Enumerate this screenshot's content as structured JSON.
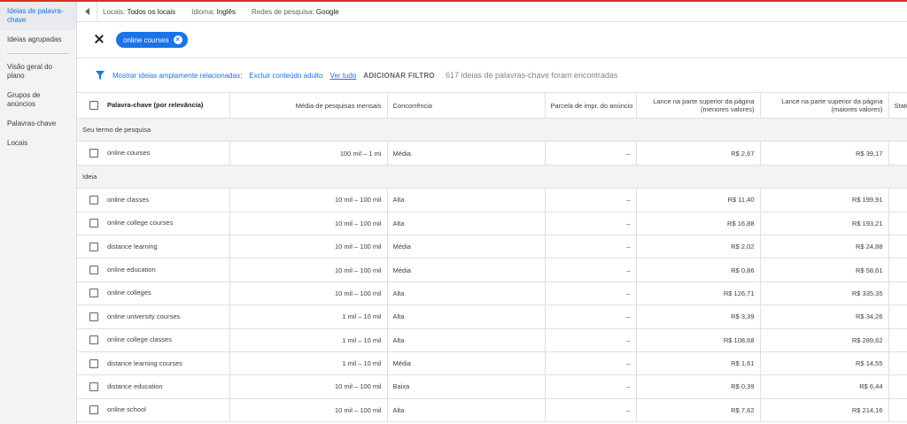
{
  "sidebar": {
    "items": [
      {
        "label": "Ideias de palavra-chave",
        "active": true
      },
      {
        "label": "Ideias agrupadas",
        "active": false
      },
      {
        "label": "Visão geral do plano",
        "active": false
      },
      {
        "label": "Grupos de anúncios",
        "active": false
      },
      {
        "label": "Palavras-chave",
        "active": false
      },
      {
        "label": "Locais",
        "active": false
      }
    ]
  },
  "topbar": {
    "locais_label": "Locais:",
    "locais_value": "Todos os locais",
    "idioma_label": "Idioma:",
    "idioma_value": "Inglês",
    "redes_label": "Redes de pesquisa:",
    "redes_value": "Google"
  },
  "chip": {
    "label": "online courses"
  },
  "filters": {
    "link1": "Mostrar ideias amplamente relacionadas;",
    "link2": "Excluir conteúdo adulto",
    "link3": "Ver tudo",
    "add_filter": "ADICIONAR FILTRO",
    "count_text": "617 ideias de palavras-chave foram encontradas"
  },
  "columns": {
    "keyword": "Palavra-chave (por relevância)",
    "avg": "Média de pesquisas mensais",
    "competition": "Concorrência",
    "share": "Parcela de impr. do anúncio",
    "bid_low": "Lance na parte superior da página (menores valores)",
    "bid_high": "Lance na parte superior da página (maiores valores)",
    "status": "Status"
  },
  "sections": {
    "term": "Seu termo de pesquisa",
    "ideas": "Ideia"
  },
  "term_row": {
    "keyword": "online courses",
    "avg": "100 mil – 1 mi",
    "competition": "Média",
    "share": "–",
    "bid_low": "R$ 2,67",
    "bid_high": "R$ 39,17"
  },
  "idea_rows": [
    {
      "keyword": "online classes",
      "avg": "10 mil – 100 mil",
      "competition": "Alta",
      "share": "–",
      "bid_low": "R$ 11,40",
      "bid_high": "R$ 199,91"
    },
    {
      "keyword": "online college courses",
      "avg": "10 mil – 100 mil",
      "competition": "Alta",
      "share": "–",
      "bid_low": "R$ 16,88",
      "bid_high": "R$ 193,21"
    },
    {
      "keyword": "distance learning",
      "avg": "10 mil – 100 mil",
      "competition": "Média",
      "share": "–",
      "bid_low": "R$ 2,02",
      "bid_high": "R$ 24,88"
    },
    {
      "keyword": "online education",
      "avg": "10 mil – 100 mil",
      "competition": "Média",
      "share": "–",
      "bid_low": "R$ 0,86",
      "bid_high": "R$ 58,61"
    },
    {
      "keyword": "online colleges",
      "avg": "10 mil – 100 mil",
      "competition": "Alta",
      "share": "–",
      "bid_low": "R$ 126,71",
      "bid_high": "R$ 335,35"
    },
    {
      "keyword": "online university courses",
      "avg": "1 mil – 10 mil",
      "competition": "Alta",
      "share": "–",
      "bid_low": "R$ 3,39",
      "bid_high": "R$ 34,26"
    },
    {
      "keyword": "online college classes",
      "avg": "1 mil – 10 mil",
      "competition": "Alta",
      "share": "–",
      "bid_low": "R$ 108,68",
      "bid_high": "R$ 289,62"
    },
    {
      "keyword": "distance learning courses",
      "avg": "1 mil – 10 mil",
      "competition": "Média",
      "share": "–",
      "bid_low": "R$ 1,61",
      "bid_high": "R$ 14,55"
    },
    {
      "keyword": "distance education",
      "avg": "10 mil – 100 mil",
      "competition": "Baixa",
      "share": "–",
      "bid_low": "R$ 0,39",
      "bid_high": "R$ 6,44"
    },
    {
      "keyword": "online school",
      "avg": "10 mil – 100 mil",
      "competition": "Alta",
      "share": "–",
      "bid_low": "R$ 7,62",
      "bid_high": "R$ 214,16"
    }
  ]
}
